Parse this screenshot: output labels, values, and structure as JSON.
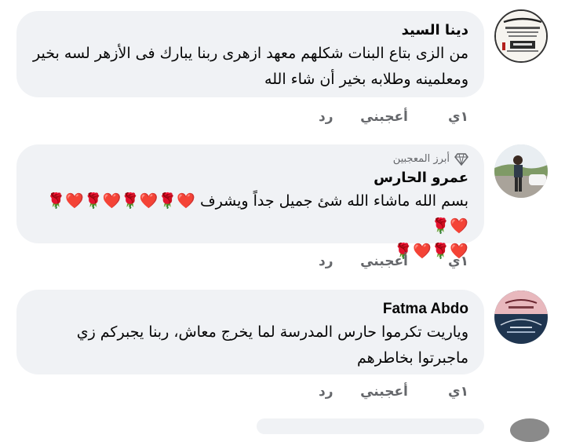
{
  "comments": [
    {
      "author": "دينا السيد",
      "text": "من الزى بتاع البنات شكلهم معهد ازهرى ربنا يبارك فى الأزهر لسه بخير ومعلمينه وطلابه بخير أن شاء الله",
      "time": "١ي",
      "like_label": "أعجبني",
      "reply_label": "رد",
      "avatar": "profile-picture"
    },
    {
      "badge": "أبرز المعجبين",
      "badge_icon": "diamond-icon",
      "author": "عمرو الحارس",
      "text": "بسم الله ماشاء الله شئ جميل جداً ويشرف",
      "emoji_line1": "❤️🌹❤️🌹❤️🌹❤️🌹❤️🌹",
      "emoji_line2": "❤️🌹❤️🌹",
      "time": "١ي",
      "like_label": "أعجبني",
      "reply_label": "رد",
      "avatar": "profile-picture"
    },
    {
      "author": "Fatma Abdo",
      "text": "وياريت تكرموا حارس المدرسة لما يخرج معاش، ربنا يجبركم زي ماجبرتوا بخاطرهم",
      "time": "١ي",
      "like_label": "أعجبني",
      "reply_label": "رد",
      "avatar": "profile-picture"
    }
  ],
  "colors": {
    "bubble": "#f0f2f5",
    "text": "#050505",
    "secondary": "#65676b",
    "heart": "#e02a3c"
  }
}
